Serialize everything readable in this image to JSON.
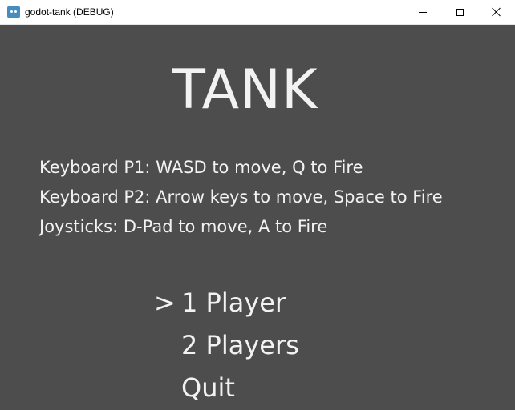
{
  "window": {
    "title": "godot-tank (DEBUG)",
    "icon": "godot-engine-icon",
    "controls": [
      "minimize-icon",
      "maximize-icon",
      "close-icon"
    ]
  },
  "game": {
    "title": "TANK",
    "help": [
      "Keyboard P1: WASD to move, Q to Fire",
      "Keyboard P2: Arrow keys to move, Space to Fire",
      "Joysticks: D-Pad to move, A to Fire"
    ],
    "menu": {
      "cursor": ">",
      "selected_index": 0,
      "items": [
        "1 Player",
        "2 Players",
        "Quit"
      ]
    }
  },
  "colors": {
    "background": "#4d4d4d",
    "text": "#f2f2f2",
    "titlebar": "#ffffff"
  }
}
